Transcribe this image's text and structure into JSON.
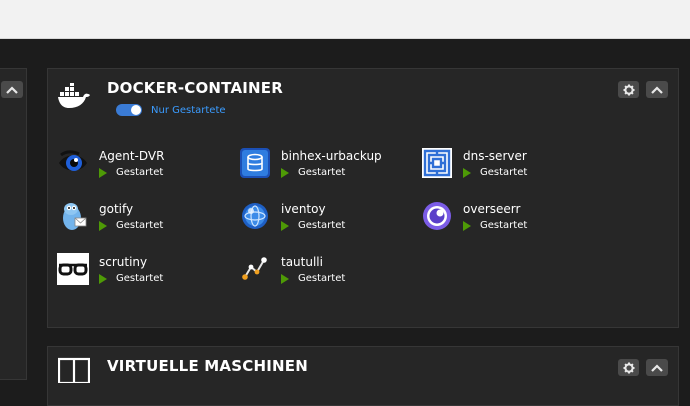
{
  "docker": {
    "title": "DOCKER-CONTAINER",
    "filter_label": "Nur Gestartete",
    "filter_on": true,
    "containers": [
      {
        "name": "Agent-DVR",
        "status": "Gestartet",
        "icon": "agent-dvr-icon"
      },
      {
        "name": "binhex-urbackup",
        "status": "Gestartet",
        "icon": "urbackup-icon"
      },
      {
        "name": "dns-server",
        "status": "Gestartet",
        "icon": "dns-server-icon"
      },
      {
        "name": "gotify",
        "status": "Gestartet",
        "icon": "gotify-icon"
      },
      {
        "name": "iventoy",
        "status": "Gestartet",
        "icon": "iventoy-icon"
      },
      {
        "name": "overseerr",
        "status": "Gestartet",
        "icon": "overseerr-icon"
      },
      {
        "name": "scrutiny",
        "status": "Gestartet",
        "icon": "scrutiny-icon"
      },
      {
        "name": "tautulli",
        "status": "Gestartet",
        "icon": "tautulli-icon"
      }
    ]
  },
  "vm": {
    "title": "VIRTUELLE MASCHINEN"
  },
  "colors": {
    "status_running": "#4e9a06",
    "toggle": "#3a7bd5",
    "filter_text": "#3b9cff",
    "panel_bg": "#262626",
    "page_bg": "#1c1c1c"
  }
}
